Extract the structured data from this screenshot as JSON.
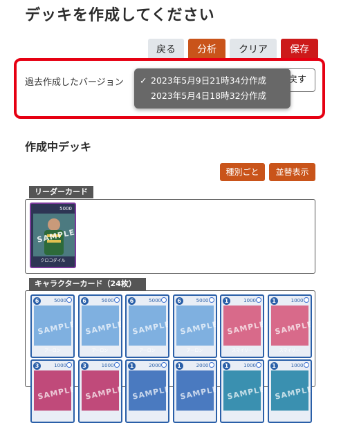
{
  "page_title": "デッキを作成してください",
  "toolbar": {
    "back": "戻る",
    "analyze": "分析",
    "clear": "クリア",
    "save": "保存"
  },
  "version": {
    "label": "過去作成したバージョン",
    "restore_label": "戻す",
    "options": [
      {
        "label": "2023年5月9日21時34分作成",
        "selected": true
      },
      {
        "label": "2023年5月4日18時32分作成",
        "selected": false
      }
    ],
    "check": "✓"
  },
  "deck": {
    "section_title": "作成中デッキ",
    "sort_by_type": "種別ごと",
    "sort_display": "並替表示",
    "leader_group": {
      "title": "リーダーカード",
      "cards": [
        {
          "name": "クロコダイル",
          "power": "5000",
          "cost": "",
          "color": "#7a3a9a",
          "art": "#3a5a6a"
        }
      ]
    },
    "character_group": {
      "title": "キャラクターカード（24枚）",
      "row1": [
        {
          "name": "アーロン",
          "power": "5000",
          "cost": "6",
          "art": "#7fb0e0"
        },
        {
          "name": "アーロン",
          "power": "5000",
          "cost": "6",
          "art": "#7fb0e0"
        },
        {
          "name": "アーロン",
          "power": "5000",
          "cost": "6",
          "art": "#7fb0e0"
        },
        {
          "name": "アーロン",
          "power": "5000",
          "cost": "6",
          "art": "#7fb0e0"
        },
        {
          "name": "スマイリー",
          "power": "1000",
          "cost": "1",
          "art": "#d86a8a"
        },
        {
          "name": "スマイリー",
          "power": "1000",
          "cost": "1",
          "art": "#d86a8a"
        }
      ],
      "row2": [
        {
          "power": "1000",
          "cost": "3",
          "art": "#c04a7a"
        },
        {
          "power": "1000",
          "cost": "3",
          "art": "#c04a7a"
        },
        {
          "power": "2000",
          "cost": "1",
          "art": "#4a7ac0"
        },
        {
          "power": "2000",
          "cost": "1",
          "art": "#4a7ac0"
        },
        {
          "power": "1000",
          "cost": "1",
          "art": "#3a90b0"
        },
        {
          "power": "1000",
          "cost": "1",
          "art": "#3a90b0"
        }
      ]
    },
    "sample_text": "SAMPLE"
  }
}
